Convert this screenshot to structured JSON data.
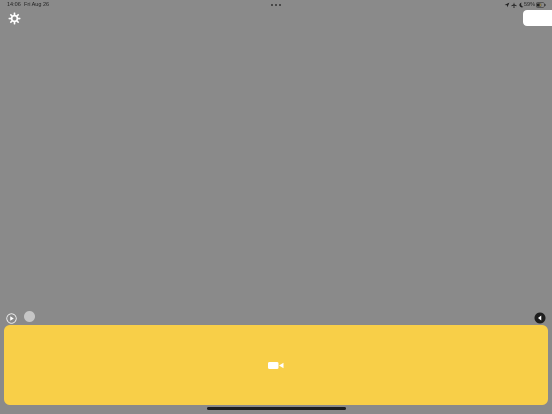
{
  "status_bar": {
    "time": "14:06",
    "date": "Fri Aug 26",
    "battery_percent": "59%",
    "icons": [
      "location-arrow-icon",
      "airplane-icon",
      "moon-icon",
      "battery-charging-icon"
    ]
  },
  "toolbar": {
    "settings_icon": "gear-icon",
    "top_right_button": "blank-white-button"
  },
  "controls": {
    "play_icon": "play-circle-icon",
    "record_dot": "gray-dot",
    "back_icon": "back-triangle-icon"
  },
  "capture_panel": {
    "icon": "video-camera-icon",
    "background_color": "#f8cf48"
  },
  "colors": {
    "background": "#8a8a8a",
    "panel": "#f8cf48",
    "home_indicator": "#1e1e1e"
  }
}
